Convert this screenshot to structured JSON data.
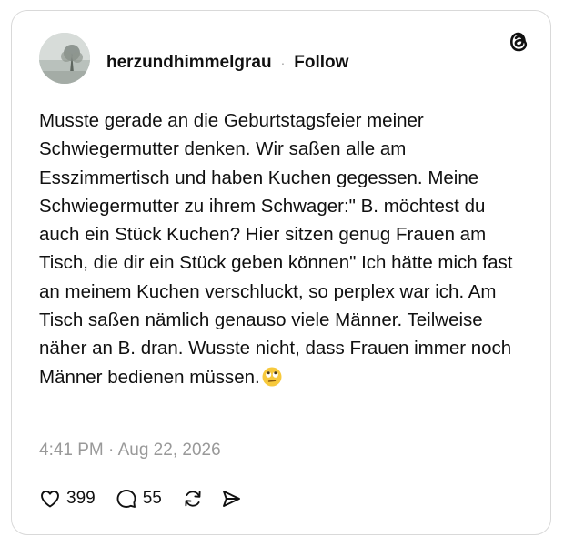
{
  "post": {
    "username": "herzundhimmelgrau",
    "separator": "·",
    "follow_label": "Follow",
    "text": "Musste gerade an die Geburtstagsfeier meiner Schwiegermutter denken. Wir saßen alle am Esszimmertisch und haben Kuchen gegessen. Meine Schwiegermutter zu ihrem Schwager:\" B. möchtest du auch ein Stück Kuchen? Hier sitzen genug Frauen am Tisch, die dir ein Stück geben können\" Ich hätte mich fast an meinem Kuchen verschluckt, so perplex war ich. Am Tisch saßen nämlich genauso viele Männer. Teilweise näher an B. dran. Wusste nicht, dass Frauen immer noch Männer bedienen müssen.",
    "emoji": "face-with-rolling-eyes",
    "timestamp": "4:41 PM · Aug 22, 2026",
    "likes": "399",
    "replies": "55"
  },
  "icons": {
    "brand": "threads-logo",
    "like": "heart-icon",
    "reply": "comment-bubble-icon",
    "repost": "repost-icon",
    "share": "send-icon"
  },
  "colors": {
    "text": "#101010",
    "muted": "#999999",
    "border": "#d9d9d9"
  }
}
